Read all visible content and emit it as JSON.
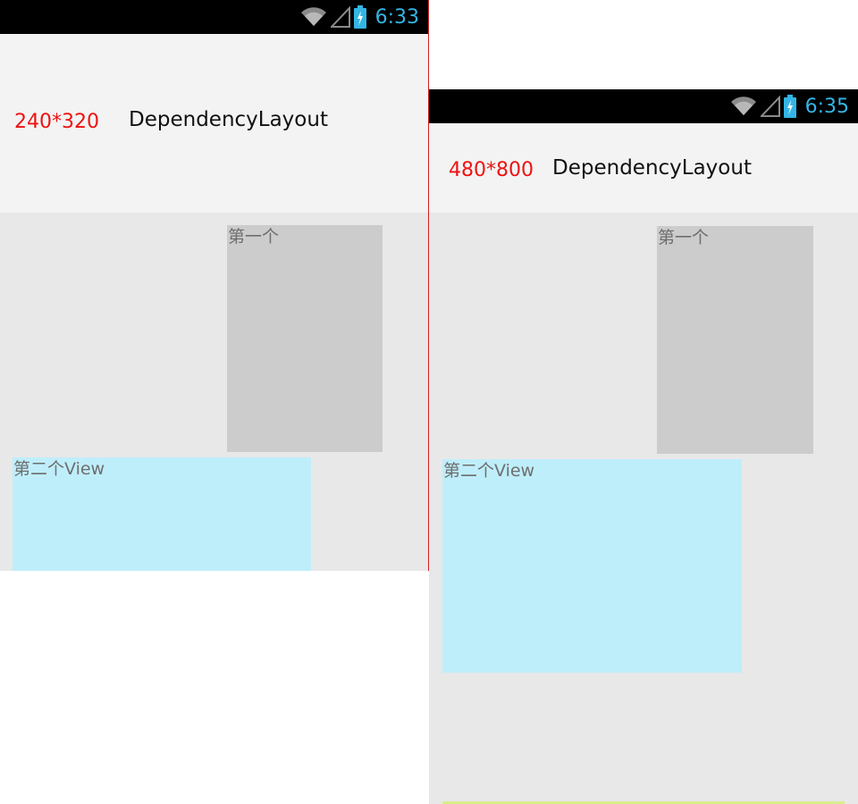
{
  "screens": [
    {
      "resolution_label": "240*320",
      "app_title": "DependencyLayout",
      "status_time": "6:33",
      "views": {
        "first_label": "第一个",
        "second_label": "第二个View"
      }
    },
    {
      "resolution_label": "480*800",
      "app_title": "DependencyLayout",
      "status_time": "6:35",
      "views": {
        "first_label": "第一个",
        "second_label": "第二个View"
      }
    }
  ],
  "colors": {
    "status_bar": "#000000",
    "clock": "#33b5e5",
    "resolution_label": "#ee1111",
    "header_bg": "#f3f3f3",
    "content_bg": "#e8e8e8",
    "first_view_bg": "#cccccc",
    "second_view_bg": "#bfeefb",
    "divider": "#d42020"
  },
  "icons": [
    "wifi-icon",
    "signal-icon",
    "battery-charging-icon"
  ]
}
